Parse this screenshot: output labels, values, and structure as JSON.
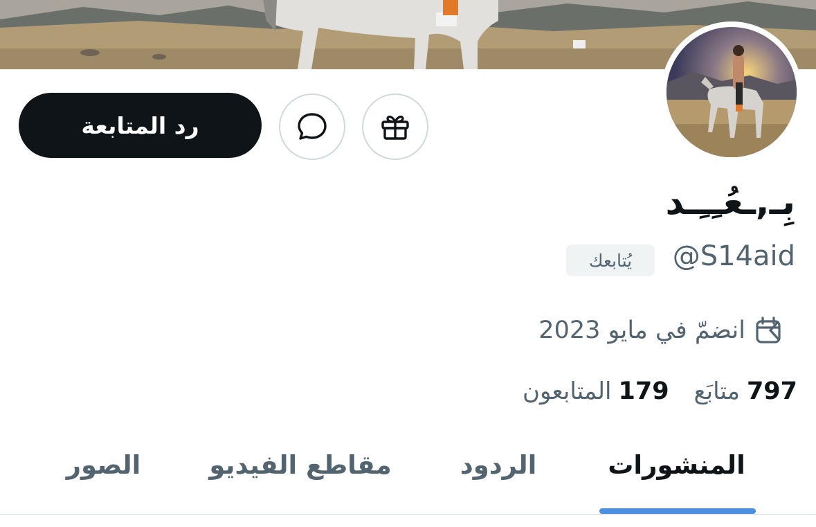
{
  "profile": {
    "display_name": "بِـ,ـعُـِـِـد",
    "handle": "@S14aid",
    "follows_you_badge": "يُتابعك",
    "joined": "انضمّ في مايو 2023"
  },
  "stats": {
    "following_count": "797",
    "following_label": "متابَع",
    "followers_count": "179",
    "followers_label": "المتابعون"
  },
  "actions": {
    "follow_back_label": "رد المتابعة"
  },
  "tabs": [
    {
      "label": "المنشورات",
      "active": true
    },
    {
      "label": "الردود",
      "active": false
    },
    {
      "label": "مقاطع الفيديو",
      "active": false
    },
    {
      "label": "الصور",
      "active": false
    }
  ],
  "colors": {
    "primary_button": "#0f1419",
    "secondary_text": "#536471",
    "tab_indicator": "#4a8fe0",
    "badge_bg": "#eff3f4"
  },
  "icons": [
    "gift-icon",
    "message-icon",
    "calendar-icon",
    "chevron-left-icon"
  ]
}
